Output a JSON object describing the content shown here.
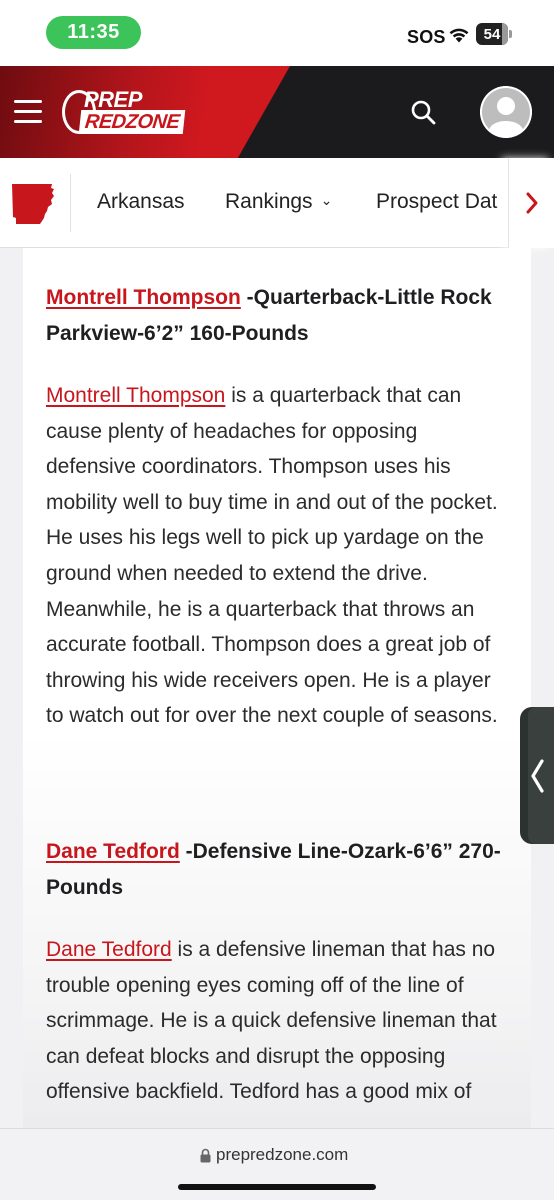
{
  "status_bar": {
    "time": "11:35",
    "sos": "SOS",
    "battery": "54",
    "wifi_icon": "wifi-icon"
  },
  "header": {
    "logo_top": "PREP",
    "logo_bottom": "REDZONE",
    "menu_icon": "hamburger-menu-icon",
    "search_icon": "search-icon",
    "avatar_icon": "user-avatar-icon",
    "accent_color": "#c8161d"
  },
  "sub_nav": {
    "state_icon": "arkansas-state-icon",
    "items": [
      {
        "label": "Arkansas"
      },
      {
        "label": "Rankings",
        "chevron": "⌄"
      },
      {
        "label": "Prospect Dat"
      }
    ],
    "scroll_icon": "chevron-right-icon"
  },
  "article": {
    "sections": [
      {
        "player": "Montrell Thompson",
        "heading_rest": " -Quarterback-Little Rock Parkview-6’2” 160-Pounds",
        "body_rest": " is a quarterback that can cause plenty of headaches for opposing defensive coordinators. Thompson uses his mobility well to buy time in and out of the pocket. He uses his legs well to pick up yardage on the ground when needed to extend the drive. Meanwhile, he is a quarterback that throws an accurate football. Thompson does a great job of throwing his wide receivers open. He is a player to watch out for over the next couple of seasons."
      },
      {
        "player": "Dane Tedford",
        "heading_rest": " -Defensive Line-Ozark-6’6” 270-Pounds",
        "body_rest": " is a defensive lineman that has no trouble opening eyes coming off of the line of scrimmage. He is a quick defensive lineman that can defeat blocks and disrupt the opposing offensive backfield. Tedford has a good mix of"
      }
    ]
  },
  "side_tab": {
    "icon": "chevron-left-icon"
  },
  "url_bar": {
    "lock_icon": "lock-icon",
    "domain": "prepredzone.com"
  }
}
